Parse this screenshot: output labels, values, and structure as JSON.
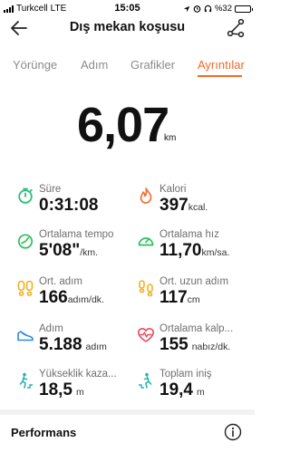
{
  "status_bar": {
    "carrier": "Turkcell",
    "network": "LTE",
    "time": "15:05",
    "battery_text": "%32",
    "battery_level": 0.32
  },
  "header": {
    "title": "Dış mekan koşusu",
    "back_icon": "arrow-left-icon",
    "share_icon": "share-icon"
  },
  "tabs": [
    {
      "label": "Yörünge",
      "active": false
    },
    {
      "label": "Adım",
      "active": false
    },
    {
      "label": "Grafikler",
      "active": false
    },
    {
      "label": "Ayrıntılar",
      "active": true
    }
  ],
  "distance": {
    "value": "6,07",
    "unit": "km"
  },
  "stats": [
    {
      "label": "Süre",
      "value": "0:31:08",
      "unit": "",
      "icon": "stopwatch-icon",
      "color": "#2bbf7a"
    },
    {
      "label": "Kalori",
      "value": "397",
      "unit": "kcal.",
      "icon": "flame-icon",
      "color": "#f26a2a"
    },
    {
      "label": "Ortalama tempo",
      "value": "5'08\"",
      "unit": "/km.",
      "icon": "pace-gauge-icon",
      "color": "#2bbf5a"
    },
    {
      "label": "Ortalama hız",
      "value": "11,70",
      "unit": "km/sa.",
      "icon": "speedometer-icon",
      "color": "#2bbf5a"
    },
    {
      "label": "Ort. adım",
      "value": "166",
      "unit": "adım/dk.",
      "icon": "footprints-icon",
      "color": "#f0b020"
    },
    {
      "label": "Ort. uzun adım",
      "value": "117",
      "unit": "cm",
      "icon": "stride-icon",
      "color": "#f0b020"
    },
    {
      "label": "Adım",
      "value": "5.188",
      "unit": "adım",
      "icon": "shoe-icon",
      "color": "#2d8ae6"
    },
    {
      "label": "Ortalama kalp...",
      "value": "155",
      "unit": "nabız/dk.",
      "icon": "heart-rate-icon",
      "color": "#e84a5f"
    },
    {
      "label": "Yükseklik kaza...",
      "value": "18,5",
      "unit": "m",
      "icon": "climb-icon",
      "color": "#27b3b3"
    },
    {
      "label": "Toplam iniş",
      "value": "19,4",
      "unit": "m",
      "icon": "descent-icon",
      "color": "#27b3b3"
    }
  ],
  "footer": {
    "title": "Performans",
    "info_icon": "info-icon"
  }
}
